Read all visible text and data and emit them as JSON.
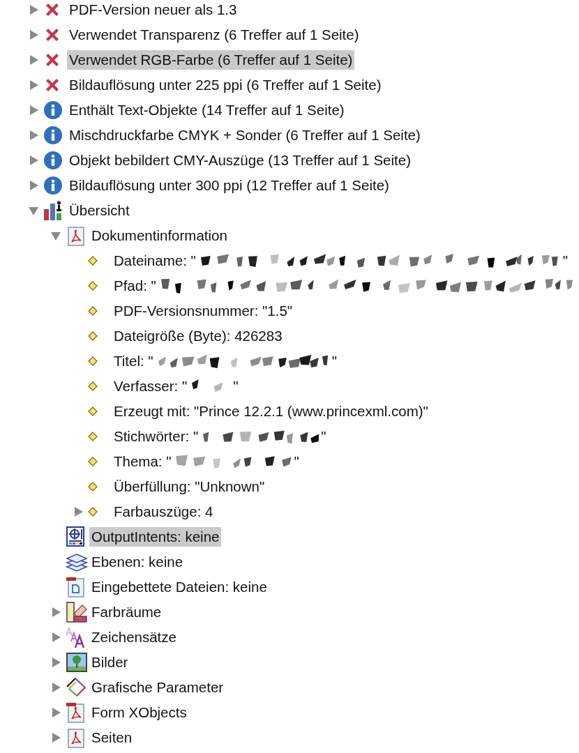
{
  "tree": [
    {
      "label": "PDF-Version neuer als 1.3",
      "kind": "error",
      "expanded": false,
      "selected": false
    },
    {
      "label": "Verwendet Transparenz (6 Treffer auf 1 Seite)",
      "kind": "error",
      "expanded": false,
      "selected": false
    },
    {
      "label": "Verwendet RGB-Farbe (6 Treffer auf 1 Seite)",
      "kind": "error",
      "expanded": false,
      "selected": true
    },
    {
      "label": "Bildauflösung unter 225 ppi (6 Treffer auf 1 Seite)",
      "kind": "error",
      "expanded": false,
      "selected": false
    },
    {
      "label": "Enthält Text-Objekte (14 Treffer auf 1 Seite)",
      "kind": "info",
      "expanded": false,
      "selected": false
    },
    {
      "label": "Mischdruckfarbe CMYK + Sonder (6 Treffer auf 1 Seite)",
      "kind": "info",
      "expanded": false,
      "selected": false
    },
    {
      "label": "Objekt bebildert CMY-Auszüge (13 Treffer auf 1 Seite)",
      "kind": "info",
      "expanded": false,
      "selected": false
    },
    {
      "label": "Bildauflösung unter 300 ppi (12 Treffer auf 1 Seite)",
      "kind": "info",
      "expanded": false,
      "selected": false
    },
    {
      "label": "Übersicht",
      "kind": "overview",
      "expanded": true,
      "selected": false,
      "children": [
        {
          "label": "Dokumentinformation",
          "kind": "pdf",
          "expanded": true,
          "selected": false,
          "children": [
            {
              "label": "Dateiname: \"",
              "kind": "property",
              "redacted": true,
              "label_end": "\"",
              "selected": false
            },
            {
              "label": "Pfad: \"",
              "kind": "property",
              "redacted": true,
              "selected": false
            },
            {
              "label": "PDF-Versionsnummer: \"1.5\"",
              "kind": "property",
              "redacted": false,
              "selected": false
            },
            {
              "label": "Dateigröße (Byte): 426283",
              "kind": "property",
              "redacted": false,
              "selected": false
            },
            {
              "label": "Titel: \"",
              "kind": "property",
              "redacted": true,
              "label_end": "\"",
              "selected": false
            },
            {
              "label": "Verfasser: \"",
              "kind": "property",
              "redacted": true,
              "label_end": "\"",
              "selected": false
            },
            {
              "label": "Erzeugt mit: \"Prince 12.2.1 (www.princexml.com)\"",
              "kind": "property",
              "redacted": false,
              "selected": false
            },
            {
              "label": "Stichwörter: \"",
              "kind": "property",
              "redacted": true,
              "label_end": "\"",
              "selected": false
            },
            {
              "label": "Thema: \"",
              "kind": "property",
              "redacted": true,
              "label_end": "\"",
              "selected": false
            },
            {
              "label": "Überfüllung: \"Unknown\"",
              "kind": "property",
              "redacted": false,
              "selected": false
            },
            {
              "label": "Farbauszüge: 4",
              "kind": "property",
              "redacted": false,
              "expanded": false,
              "selected": false
            }
          ]
        },
        {
          "label": "OutputIntents: keine",
          "kind": "outputintent",
          "selected": true
        },
        {
          "label": "Ebenen: keine",
          "kind": "layers",
          "selected": false
        },
        {
          "label": "Eingebettete Dateien: keine",
          "kind": "embedded",
          "selected": false
        },
        {
          "label": "Farbräume",
          "kind": "colorspace",
          "expanded": false,
          "selected": false
        },
        {
          "label": "Zeichensätze",
          "kind": "fonts",
          "expanded": false,
          "selected": false
        },
        {
          "label": "Bilder",
          "kind": "images",
          "expanded": false,
          "selected": false
        },
        {
          "label": "Grafische Parameter",
          "kind": "graphics",
          "expanded": false,
          "selected": false
        },
        {
          "label": "Form XObjects",
          "kind": "formxobject",
          "expanded": false,
          "selected": false
        },
        {
          "label": "Seiten",
          "kind": "pdf",
          "expanded": false,
          "selected": false
        }
      ]
    }
  ]
}
